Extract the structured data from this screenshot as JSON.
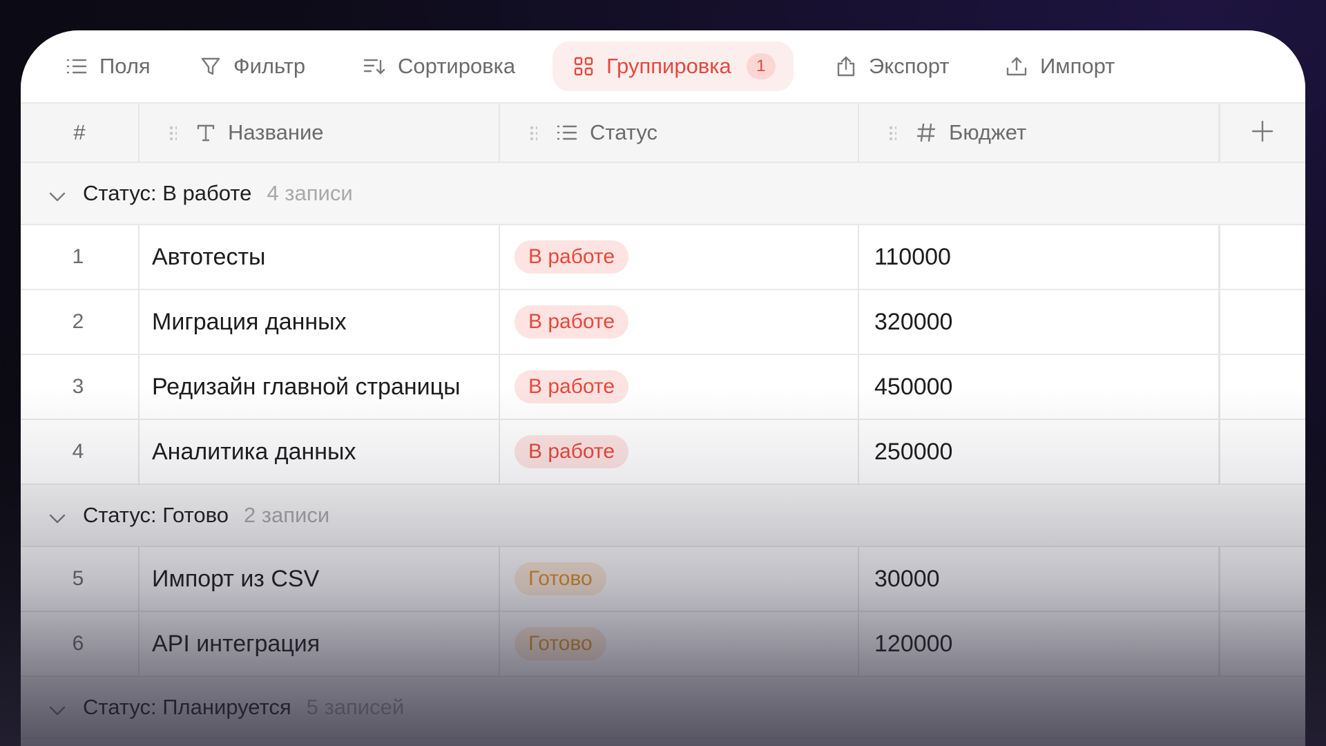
{
  "toolbar": {
    "fields_label": "Поля",
    "filter_label": "Фильтр",
    "sort_label": "Сортировка",
    "group_label": "Группировка",
    "group_count": "1",
    "export_label": "Экспорт",
    "import_label": "Импорт"
  },
  "columns": {
    "index": "#",
    "name": "Название",
    "status": "Статус",
    "budget": "Бюджет"
  },
  "groups": [
    {
      "title": "Статус: В работе",
      "count": "4 записи",
      "rows": [
        {
          "n": "1",
          "name": "Автотесты",
          "status": "В работе",
          "budget": "110000"
        },
        {
          "n": "2",
          "name": "Миграция данных",
          "status": "В работе",
          "budget": "320000"
        },
        {
          "n": "3",
          "name": "Редизайн главной страницы",
          "status": "В работе",
          "budget": "450000"
        },
        {
          "n": "4",
          "name": "Аналитика данных",
          "status": "В работе",
          "budget": "250000"
        }
      ]
    },
    {
      "title": "Статус: Готово",
      "count": "2 записи",
      "rows": [
        {
          "n": "5",
          "name": "Импорт из CSV",
          "status": "Готово",
          "budget": "30000"
        },
        {
          "n": "6",
          "name": "API интеграция",
          "status": "Готово",
          "budget": "120000"
        }
      ]
    },
    {
      "title": "Статус: Планируется",
      "count": "5 записей",
      "rows": []
    }
  ],
  "colors": {
    "accent": "#e8473b",
    "work_bg": "#fde3e1",
    "done_text": "#e0902c",
    "done_bg": "#fdecd9"
  }
}
